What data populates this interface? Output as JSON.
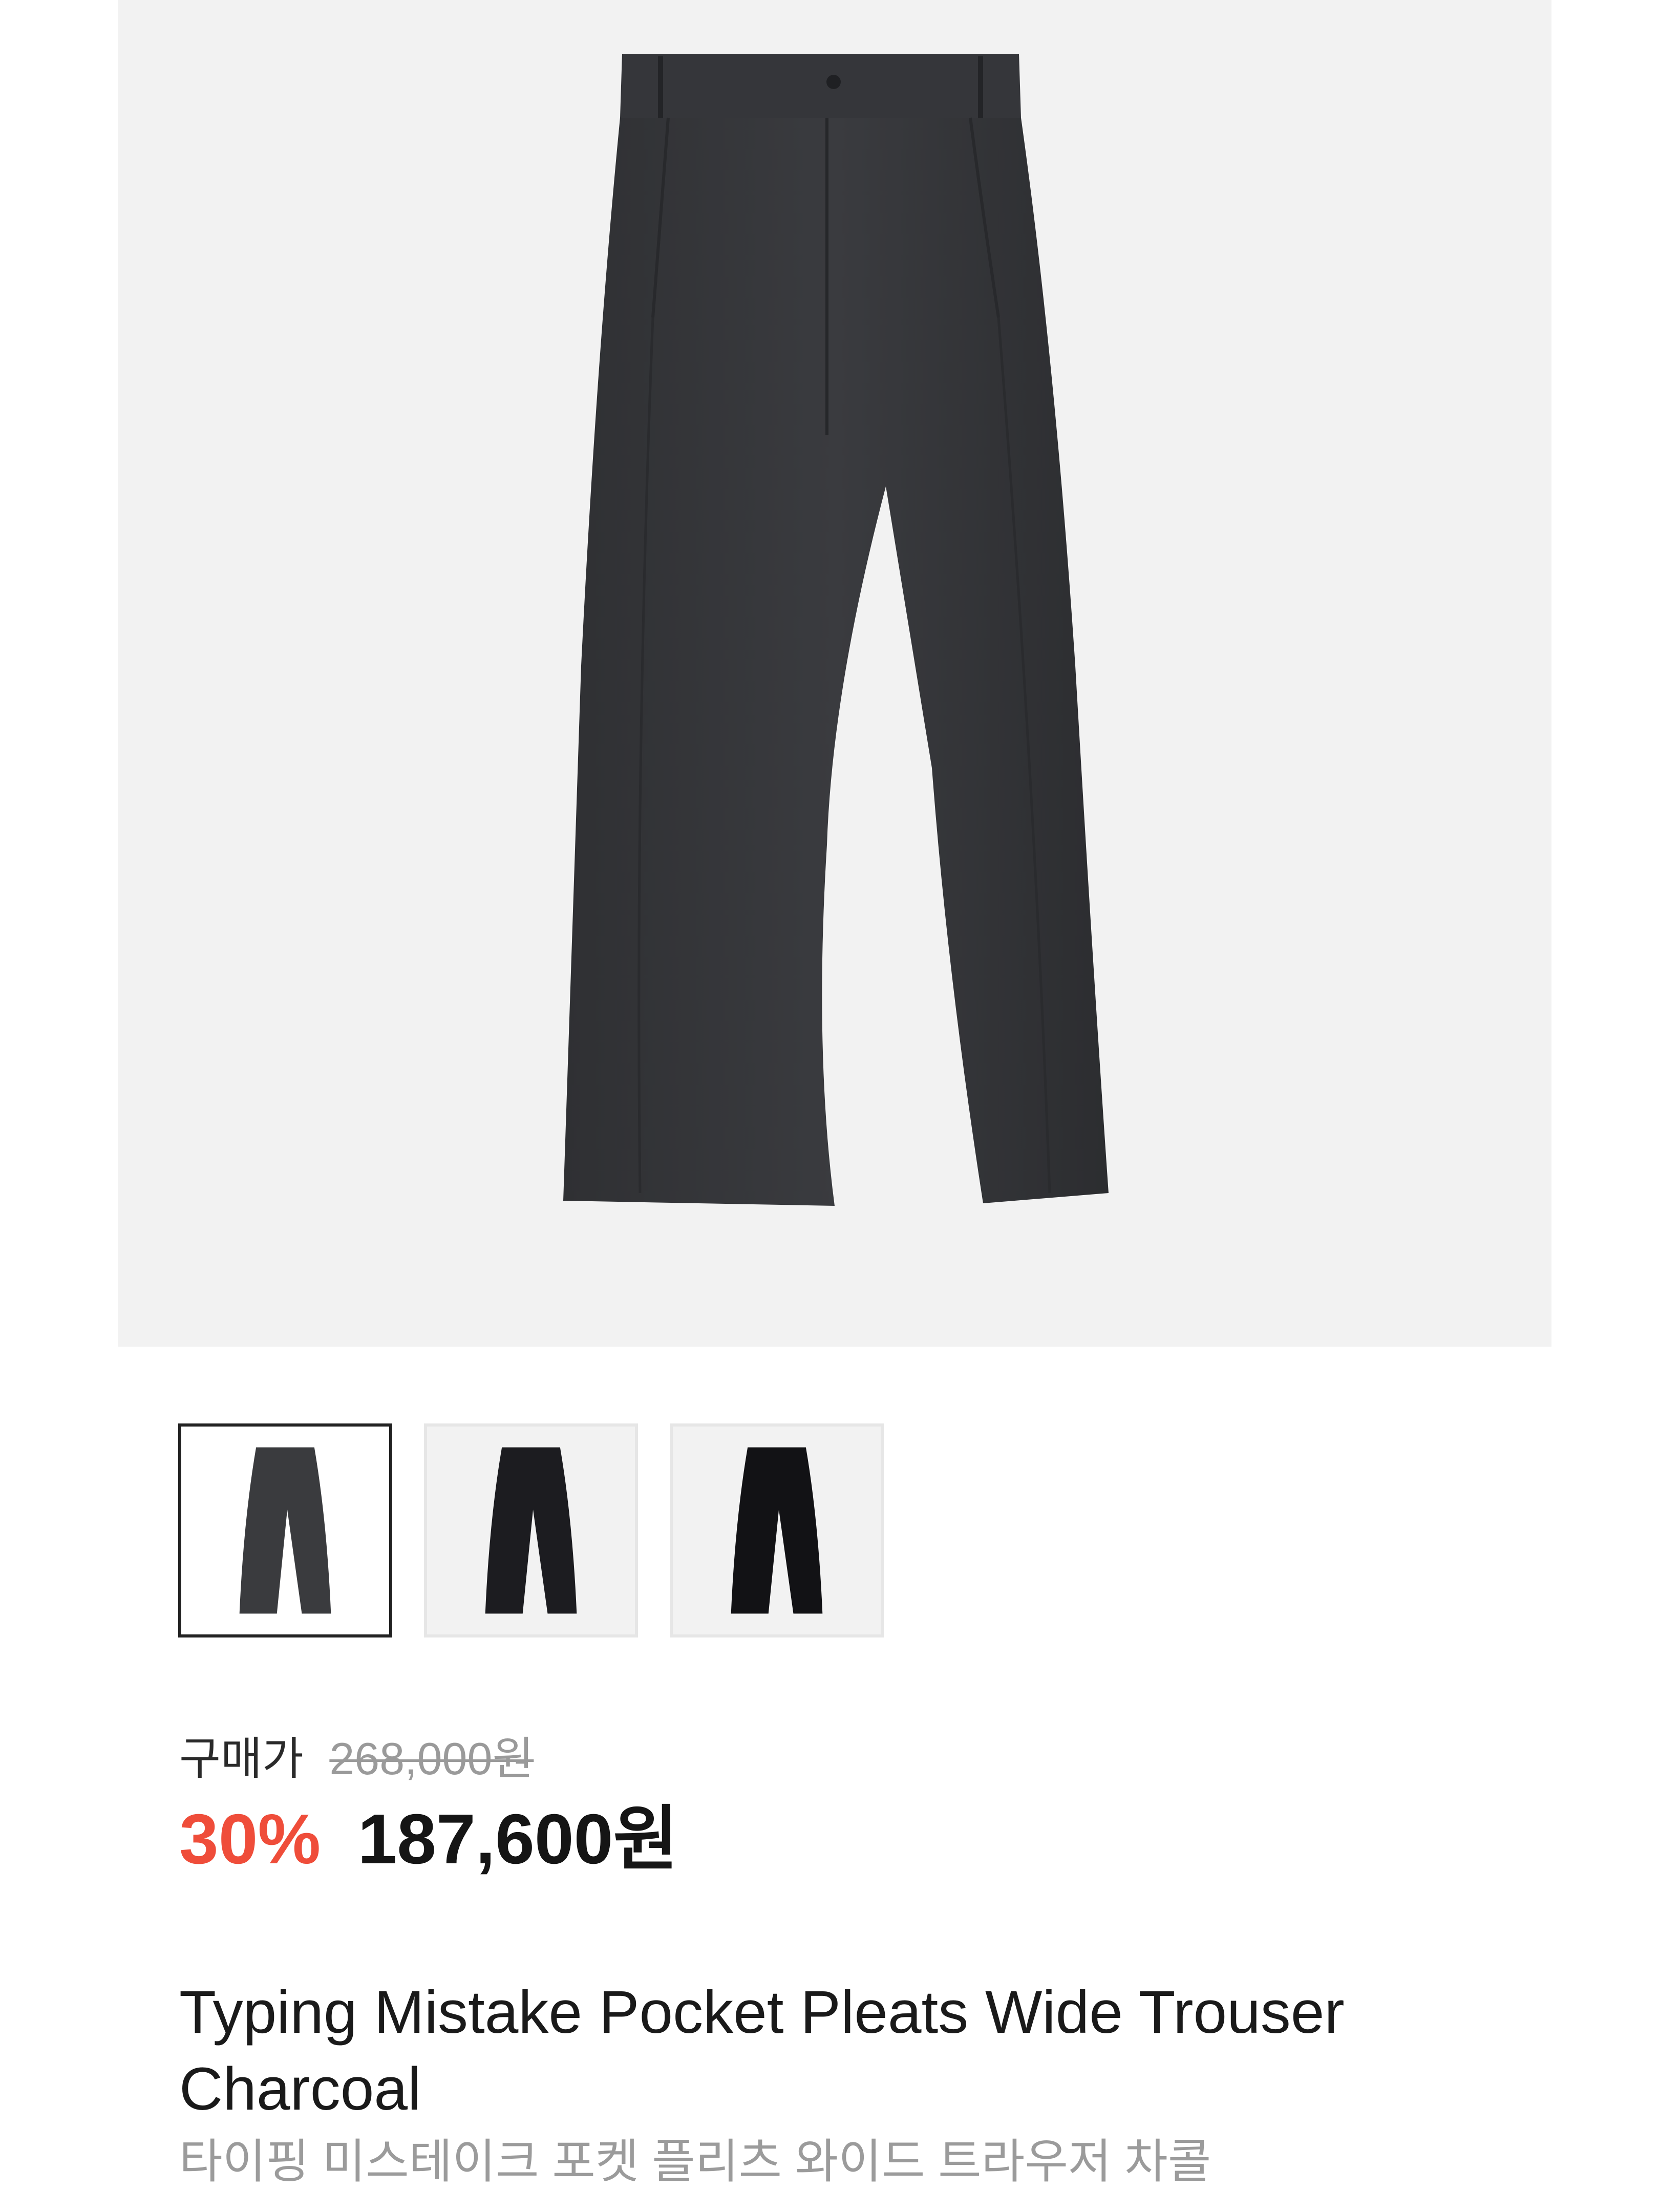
{
  "product": {
    "main_image": "charcoal-wide-trousers",
    "thumbnails": [
      {
        "name": "thumbnail-charcoal",
        "color": "#3a3b3e",
        "selected": true
      },
      {
        "name": "thumbnail-black-1",
        "color": "#1c1c20",
        "selected": false
      },
      {
        "name": "thumbnail-black-2",
        "color": "#121215",
        "selected": false
      }
    ],
    "price": {
      "label": "구매가",
      "original": "268,000원",
      "discount": "30%",
      "sale": "187,600원"
    },
    "title_en": "Typing Mistake Pocket Pleats Wide Trouser Charcoal",
    "title_ko": "타이핑 미스테이크 포켓 플리츠 와이드 트라우저 차콜"
  },
  "colors": {
    "discount": "#ef4d3a",
    "hero_background": "#f2f2f2",
    "selected_border": "#222222",
    "muted_text": "#9b9b9b"
  }
}
